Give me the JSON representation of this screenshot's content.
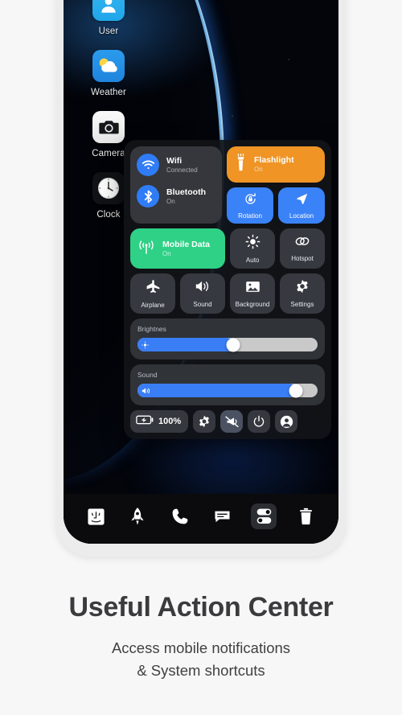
{
  "theme": {
    "page_bg": "#f7f7f8",
    "accent_blue": "#3a7ef5",
    "accent_orange": "#ef9425",
    "accent_green": "#2fd186",
    "panel_bg": "#111318",
    "tile_bg": "#36393f"
  },
  "home": {
    "apps": [
      {
        "label": "User",
        "icon": "user-icon"
      },
      {
        "label": "Weather",
        "icon": "weather-icon"
      },
      {
        "label": "Camera",
        "icon": "camera-icon"
      },
      {
        "label": "Clock",
        "icon": "clock-icon"
      }
    ]
  },
  "control_center": {
    "connectivity": [
      {
        "title": "Wifi",
        "subtitle": "Connected",
        "icon": "wifi-icon"
      },
      {
        "title": "Bluetooth",
        "subtitle": "On",
        "icon": "bluetooth-icon"
      }
    ],
    "flashlight": {
      "title": "Flashlight",
      "subtitle": "On",
      "icon": "flashlight-icon"
    },
    "small_tiles": [
      {
        "label": "Rotation",
        "icon": "rotation-lock-icon",
        "state": "on"
      },
      {
        "label": "Location",
        "icon": "location-arrow-icon",
        "state": "on"
      }
    ],
    "mobile_data": {
      "title": "Mobile Data",
      "subtitle": "On",
      "icon": "cell-signal-icon"
    },
    "tiles_row2": [
      {
        "label": "Auto",
        "icon": "brightness-auto-icon"
      },
      {
        "label": "Hotspot",
        "icon": "hotspot-icon"
      }
    ],
    "tiles_row3": [
      {
        "label": "Airplane",
        "icon": "airplane-icon"
      },
      {
        "label": "Sound",
        "icon": "speaker-icon"
      },
      {
        "label": "Background",
        "icon": "image-icon"
      },
      {
        "label": "Settings",
        "icon": "gear-icon"
      }
    ],
    "sliders": [
      {
        "label": "Brightnes",
        "value": 53,
        "icon": "brightness-icon"
      },
      {
        "label": "Sound",
        "value": 88,
        "icon": "volume-icon"
      }
    ],
    "actions": {
      "battery": {
        "text": "100%",
        "icon": "battery-charging-icon"
      },
      "buttons": [
        {
          "icon": "gear-icon",
          "state": "normal"
        },
        {
          "icon": "megaphone-mute-icon",
          "state": "highlighted"
        },
        {
          "icon": "power-icon",
          "state": "normal"
        },
        {
          "icon": "account-icon",
          "state": "normal"
        }
      ]
    }
  },
  "dock": {
    "items": [
      {
        "icon": "finder-icon",
        "active": false
      },
      {
        "icon": "rocket-icon",
        "active": false
      },
      {
        "icon": "phone-icon",
        "active": false
      },
      {
        "icon": "message-icon",
        "active": false
      },
      {
        "icon": "toggles-icon",
        "active": true
      },
      {
        "icon": "trash-icon",
        "active": false
      }
    ]
  },
  "caption": {
    "title": "Useful Action Center",
    "subtitle_line1": "Access mobile notifications",
    "subtitle_line2": "& System shortcuts"
  }
}
